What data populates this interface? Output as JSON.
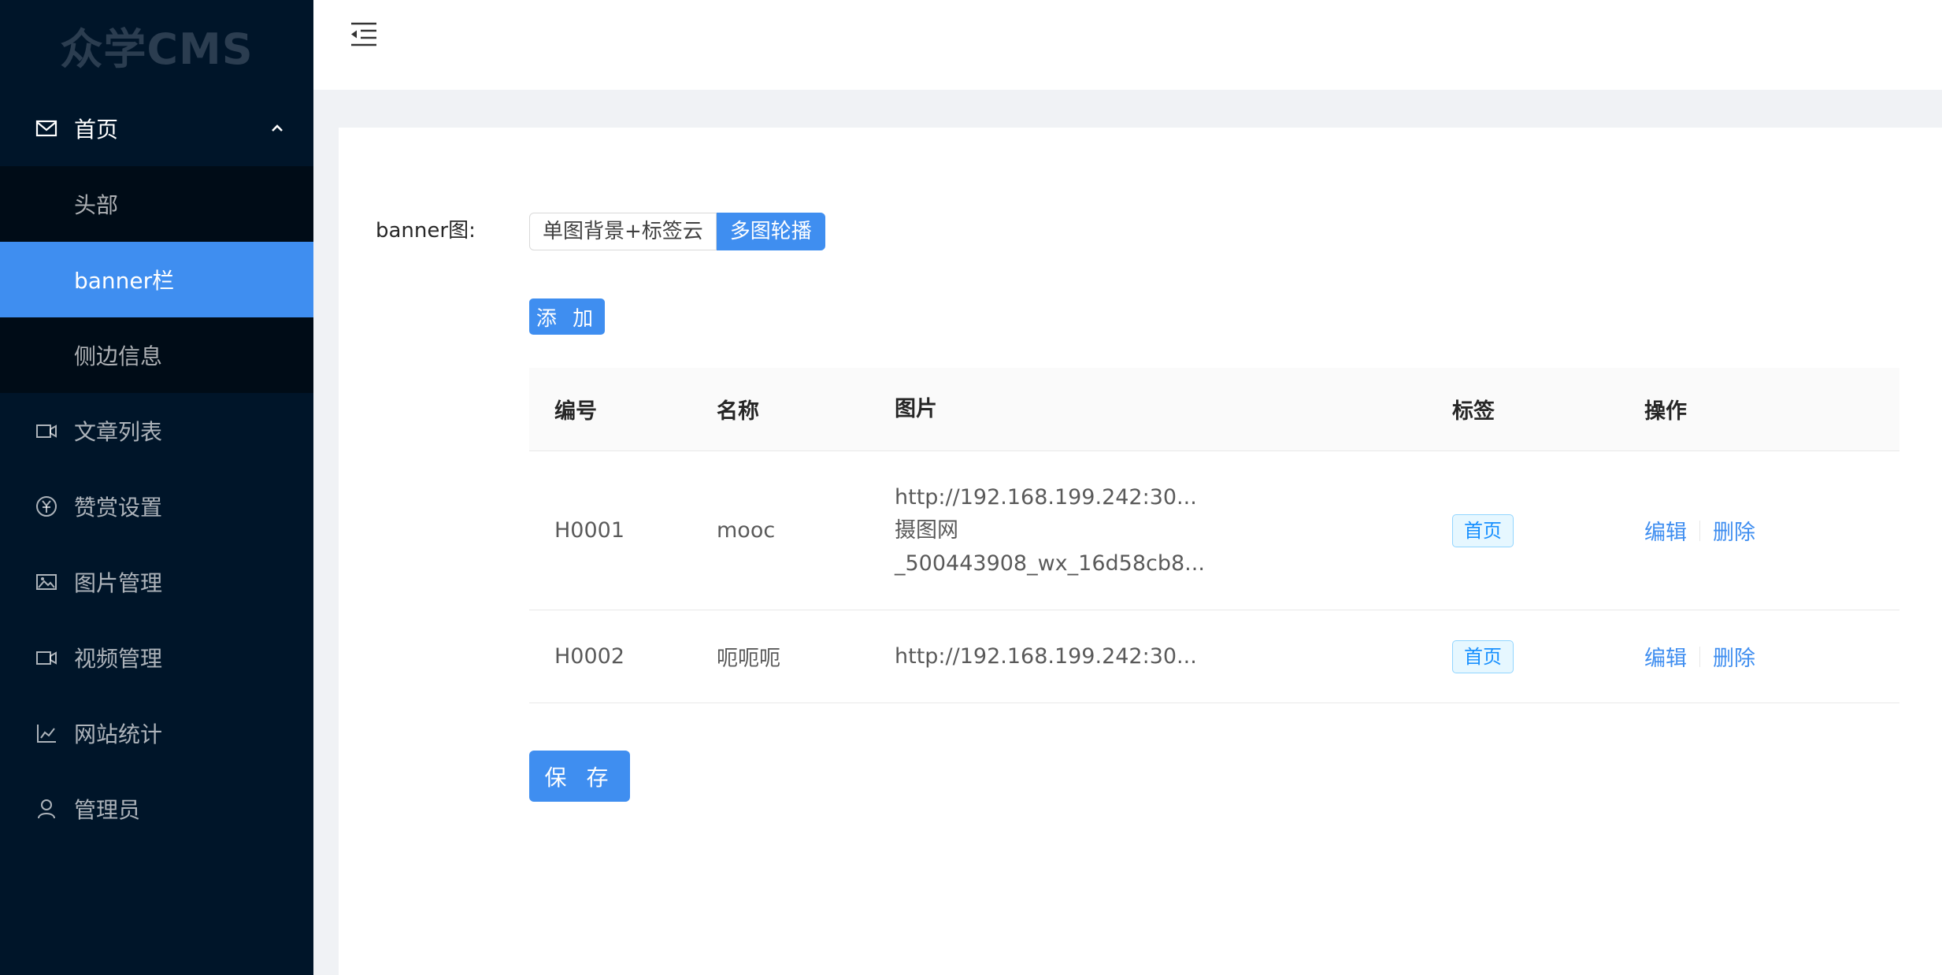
{
  "app": {
    "logo_text": "众学CMS"
  },
  "sidebar": {
    "items": [
      {
        "label": "首页",
        "icon": "mail-icon"
      },
      {
        "label": "文章列表",
        "icon": "video-camera-icon"
      },
      {
        "label": "赞赏设置",
        "icon": "yen-circle-icon"
      },
      {
        "label": "图片管理",
        "icon": "picture-icon"
      },
      {
        "label": "视频管理",
        "icon": "video-camera-icon"
      },
      {
        "label": "网站统计",
        "icon": "line-chart-icon"
      },
      {
        "label": "管理员",
        "icon": "user-icon"
      }
    ],
    "submenu": [
      {
        "label": "头部"
      },
      {
        "label": "banner栏"
      },
      {
        "label": "侧边信息"
      }
    ]
  },
  "colors": {
    "primary": "#3f8ef0",
    "sidebar_bg": "#001529",
    "submenu_bg": "#000c17"
  },
  "form": {
    "banner_label": "banner图:",
    "radio_options": [
      "单图背景+标签云",
      "多图轮播"
    ],
    "selected_option": "多图轮播",
    "add_label": "添 加",
    "save_label": "保 存"
  },
  "table": {
    "headers": [
      "编号",
      "名称",
      "图片",
      "标签",
      "操作"
    ],
    "rows": [
      {
        "id": "H0001",
        "name": "mooc",
        "images": [
          "http://192.168.199.242:30...",
          "摄图网",
          "_500443908_wx_16d58cb8..."
        ],
        "tag": "首页",
        "edit": "编辑",
        "delete": "删除"
      },
      {
        "id": "H0002",
        "name": "呃呃呃",
        "images": [
          "http://192.168.199.242:30..."
        ],
        "tag": "首页",
        "edit": "编辑",
        "delete": "删除"
      }
    ]
  }
}
